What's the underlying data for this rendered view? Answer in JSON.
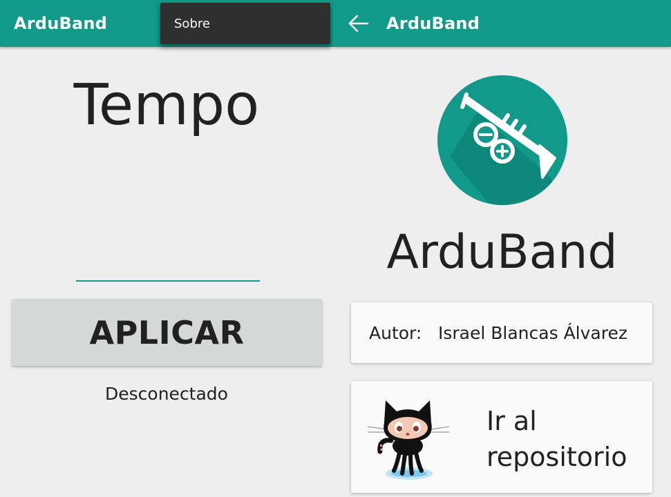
{
  "left_screen": {
    "appbar": {
      "title": "ArduBand"
    },
    "overflow_menu": {
      "items": [
        {
          "label": "Sobre"
        }
      ]
    },
    "tempo_label": "Tempo",
    "tempo_input": {
      "value": "",
      "placeholder": ""
    },
    "apply_button": {
      "label": "APLICAR"
    },
    "status": "Desconectado"
  },
  "right_screen": {
    "appbar": {
      "title": "ArduBand",
      "back_icon": "arrow-left-icon"
    },
    "logo": {
      "icon": "trumpet-infinity-logo",
      "circle_color": "#11998a"
    },
    "app_name": "ArduBand",
    "author": {
      "label": "Autor:",
      "name": "Israel Blancas Álvarez"
    },
    "repository": {
      "label": "Ir al repositorio",
      "icon": "octocat-icon"
    }
  },
  "colors": {
    "primary": "#11998a",
    "background": "#eeeeee",
    "button": "#d6d7d7",
    "menu": "#2f2f2f"
  }
}
